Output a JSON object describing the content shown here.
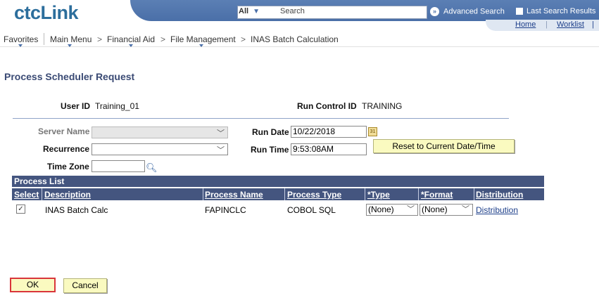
{
  "header": {
    "logo": "ctcLink",
    "search_scope": "All",
    "search_placeholder": "Search",
    "advanced_search": "Advanced Search",
    "last_search": "Last Search Results",
    "home": "Home",
    "worklist": "Worklist",
    "separator": "|"
  },
  "breadcrumb": {
    "items": [
      "Favorites",
      "Main Menu",
      "Financial Aid",
      "File Management",
      "INAS Batch Calculation"
    ],
    "separator": ">"
  },
  "page": {
    "title": "Process Scheduler Request",
    "user_id_label": "User ID",
    "user_id_value": "Training_01",
    "run_control_label": "Run Control ID",
    "run_control_value": "TRAINING",
    "server_name_label": "Server Name",
    "server_name_value": "",
    "recurrence_label": "Recurrence",
    "recurrence_value": "",
    "time_zone_label": "Time Zone",
    "time_zone_value": "",
    "run_date_label": "Run Date",
    "run_date_value": "10/22/2018",
    "run_time_label": "Run Time",
    "run_time_value": "9:53:08AM",
    "reset_button": "Reset to Current Date/Time",
    "calendar_icon_text": "31"
  },
  "process_list": {
    "title": "Process List",
    "columns": [
      "Select",
      "Description",
      "Process Name",
      "Process Type",
      "*Type",
      "*Format",
      "Distribution"
    ],
    "rows": [
      {
        "selected": true,
        "description": "INAS Batch Calc",
        "process_name": "FAPINCLC",
        "process_type": "COBOL SQL",
        "type": "(None)",
        "format": "(None)",
        "distribution": "Distribution"
      }
    ]
  },
  "footer": {
    "ok_button": "OK",
    "cancel_button": "Cancel"
  },
  "colors": {
    "brand_band": "#4a6fa8",
    "grid_header": "#44557f",
    "button_bg": "#fafac0",
    "ok_highlight": "#d9353a",
    "link": "#1d3f8a"
  }
}
